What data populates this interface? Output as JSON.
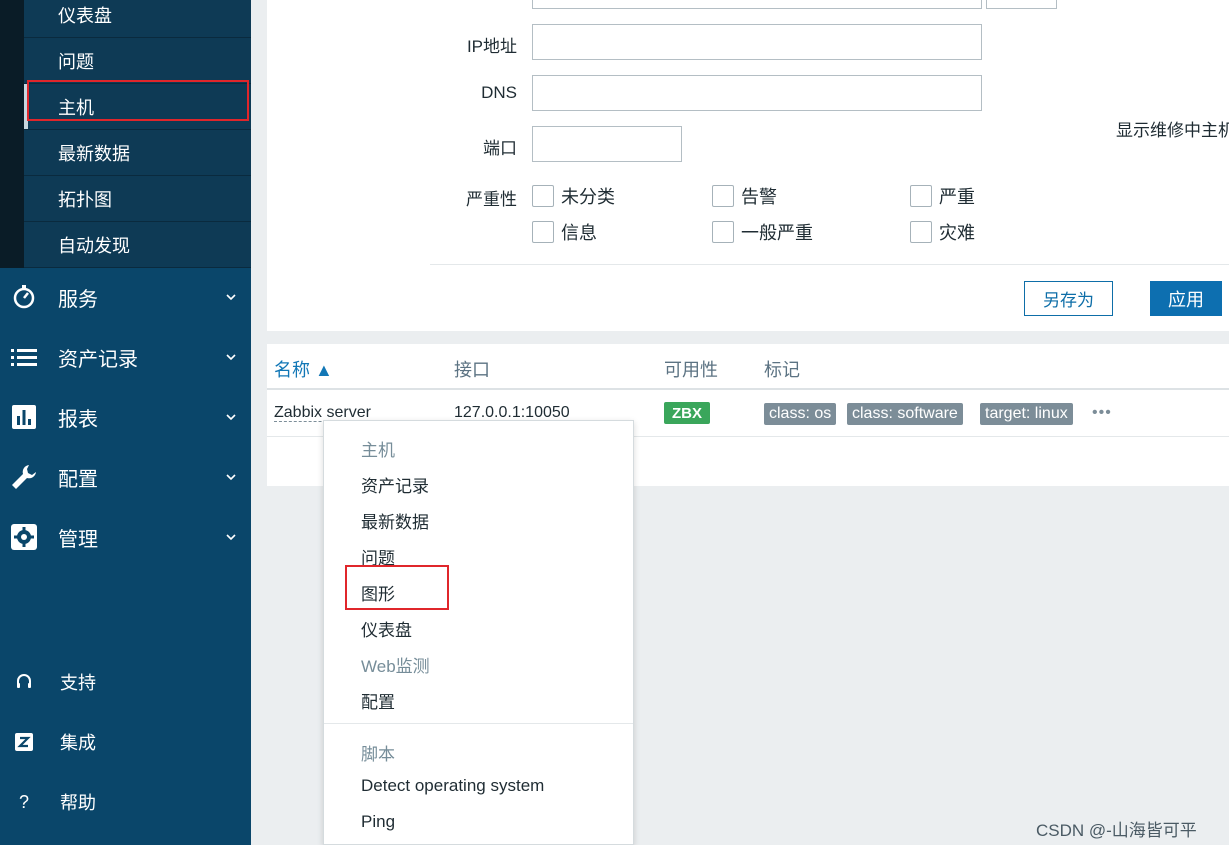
{
  "sidebar": {
    "submenu": [
      {
        "label": "仪表盘",
        "active": false
      },
      {
        "label": "问题",
        "active": false
      },
      {
        "label": "主机",
        "active": true
      },
      {
        "label": "最新数据",
        "active": false
      },
      {
        "label": "拓扑图",
        "active": false
      },
      {
        "label": "自动发现",
        "active": false
      }
    ],
    "menu": [
      {
        "label": "服务",
        "icon": "stopwatch-icon"
      },
      {
        "label": "资产记录",
        "icon": "list-icon"
      },
      {
        "label": "报表",
        "icon": "bar-chart-icon"
      },
      {
        "label": "配置",
        "icon": "wrench-icon"
      },
      {
        "label": "管理",
        "icon": "gear-icon"
      }
    ],
    "bottom": [
      {
        "label": "支持",
        "icon": "headset-icon"
      },
      {
        "label": "集成",
        "icon": "zabbix-z-icon"
      },
      {
        "label": "帮助",
        "icon": "question-icon"
      }
    ]
  },
  "filter": {
    "ip_label": "IP地址",
    "ip_value": "",
    "dns_label": "DNS",
    "dns_value": "",
    "port_label": "端口",
    "port_value": "",
    "maintenance_label": "显示维修中主机",
    "severity_label": "严重性",
    "severities": [
      "未分类",
      "告警",
      "严重",
      "信息",
      "一般严重",
      "灾难"
    ],
    "save_as_label": "另存为",
    "apply_label": "应用"
  },
  "table": {
    "headers": {
      "name": "名称 ▲",
      "interface": "接口",
      "availability": "可用性",
      "tags": "标记"
    },
    "rows": [
      {
        "name": "Zabbix server",
        "interface": "127.0.0.1:10050",
        "availability": "ZBX",
        "tags": [
          "class: os",
          "class: software",
          "target: linux"
        ],
        "more": "•••"
      }
    ]
  },
  "context_menu": {
    "host_header": "主机",
    "items": [
      "资产记录",
      "最新数据",
      "问题",
      "图形",
      "仪表盘",
      "Web监测",
      "配置"
    ],
    "scripts_header": "脚本",
    "scripts": [
      "Detect operating system",
      "Ping"
    ]
  },
  "watermark": "CSDN @-山海皆可平",
  "colors": {
    "sidebar_bg": "#0a466a",
    "submenu_bg": "#0e3a55",
    "accent": "#0d6fb0",
    "available": "#3aa65b",
    "tag_bg": "#7c8d98",
    "highlight_box": "#e0262b"
  }
}
